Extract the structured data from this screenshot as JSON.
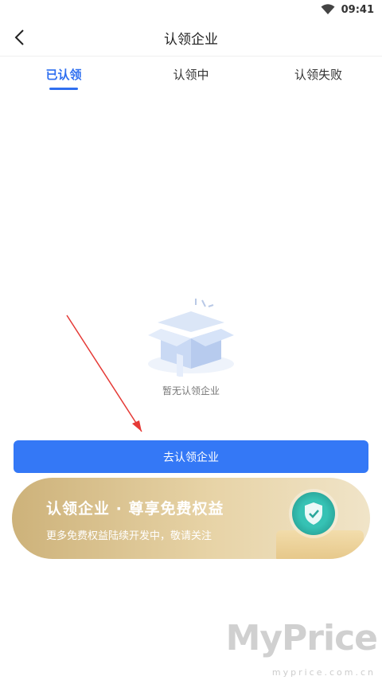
{
  "status_bar": {
    "time": "09:41",
    "wifi_icon": "wifi-icon"
  },
  "nav": {
    "title": "认领企业",
    "back_icon": "back-arrow-icon"
  },
  "tabs": [
    {
      "label": "已认领",
      "active": true
    },
    {
      "label": "认领中",
      "active": false
    },
    {
      "label": "认领失败",
      "active": false
    }
  ],
  "empty_state": {
    "icon": "empty-box-icon",
    "text": "暂无认领企业"
  },
  "actions": {
    "claim_button": "去认领企业"
  },
  "banner": {
    "title": "认领企业 · 尊享免费权益",
    "subtitle": "更多免费权益陆续开发中，敬请关注",
    "icon": "shield-check-icon"
  },
  "watermark": {
    "main": "MyPrice",
    "sub": "myprice.com.cn"
  },
  "colors": {
    "accent": "#3478f6",
    "tab_active": "#2f6ff0",
    "banner_gold": "#cdb27a"
  }
}
